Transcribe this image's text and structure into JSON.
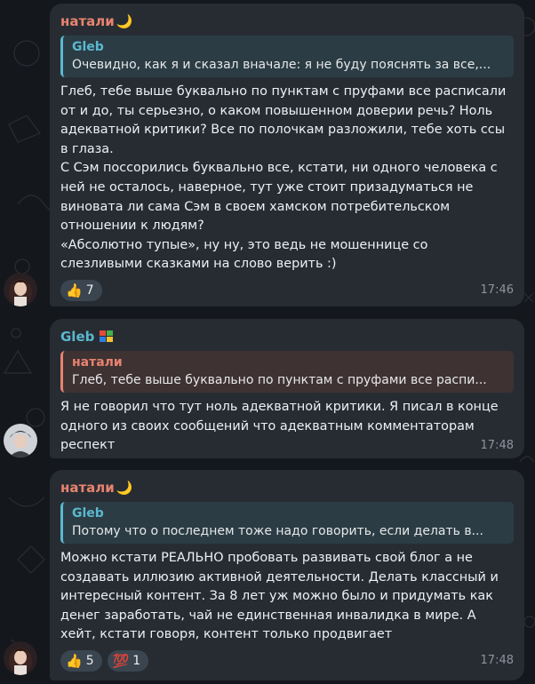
{
  "messages": [
    {
      "sender": "натали",
      "sender_emoji": "🌙",
      "sender_color": "#e8836f",
      "reply": {
        "name": "Gleb",
        "text": "Очевидно, как я и сказал вначале: я не буду пояснять за все,...",
        "accent": "#5bb8cf",
        "bg": "#2b3c44"
      },
      "lines": [
        "Глеб, тебе выше буквально по пунктам с пруфами все расписали",
        "от и до, ты серьезно, о каком повышенном доверии речь? Ноль",
        "адекватной критики? Все по полочкам разложили, тебе хоть ссы",
        "в глаза.",
        "С Сэм поссорились буквально все, кстати, ни одного человека с",
        "ней не осталось, наверное, тут уже стоит призадуматься не",
        "виновата ли сама Сэм в своем хамском потребительском",
        "отношении к людям?",
        "«Абсолютно тупые», ну ну, это ведь не мошеннице со",
        "слезливыми сказками на слово верить :)"
      ],
      "reactions": [
        {
          "emoji": "👍",
          "count": "7"
        }
      ],
      "time": "17:46"
    },
    {
      "sender": "Gleb",
      "sender_emoji": "🪟",
      "sender_color": "#5bb8cf",
      "reply": {
        "name": "натали",
        "text": "Глеб, тебе выше буквально по пунктам с пруфами все распи...",
        "accent": "#e8836f",
        "bg": "#3e3233"
      },
      "lines": [
        "Я не говорил что тут ноль адекватной критики. Я писал в конце",
        "одного из своих сообщений что адекватным комментаторам",
        "респект"
      ],
      "reactions": [],
      "time": "17:48"
    },
    {
      "sender": "натали",
      "sender_emoji": "🌙",
      "sender_color": "#e8836f",
      "reply": {
        "name": "Gleb",
        "text": "Потому что о последнем тоже надо говорить, если делать в...",
        "accent": "#5bb8cf",
        "bg": "#2b3c44"
      },
      "lines": [
        "Можно кстати РЕАЛЬНО пробовать развивать свой блог а не",
        "создавать иллюзию активной деятельности. Делать классный и",
        "интересный контент. За 8 лет уж можно было и придумать как",
        "денег заработать, чай не единственная инвалидка в мире. А",
        "хейт, кстати говоря, контент только продвигает"
      ],
      "reactions": [
        {
          "emoji": "👍",
          "count": "5"
        },
        {
          "emoji": "💯",
          "count": "1"
        }
      ],
      "time": "17:48"
    }
  ]
}
